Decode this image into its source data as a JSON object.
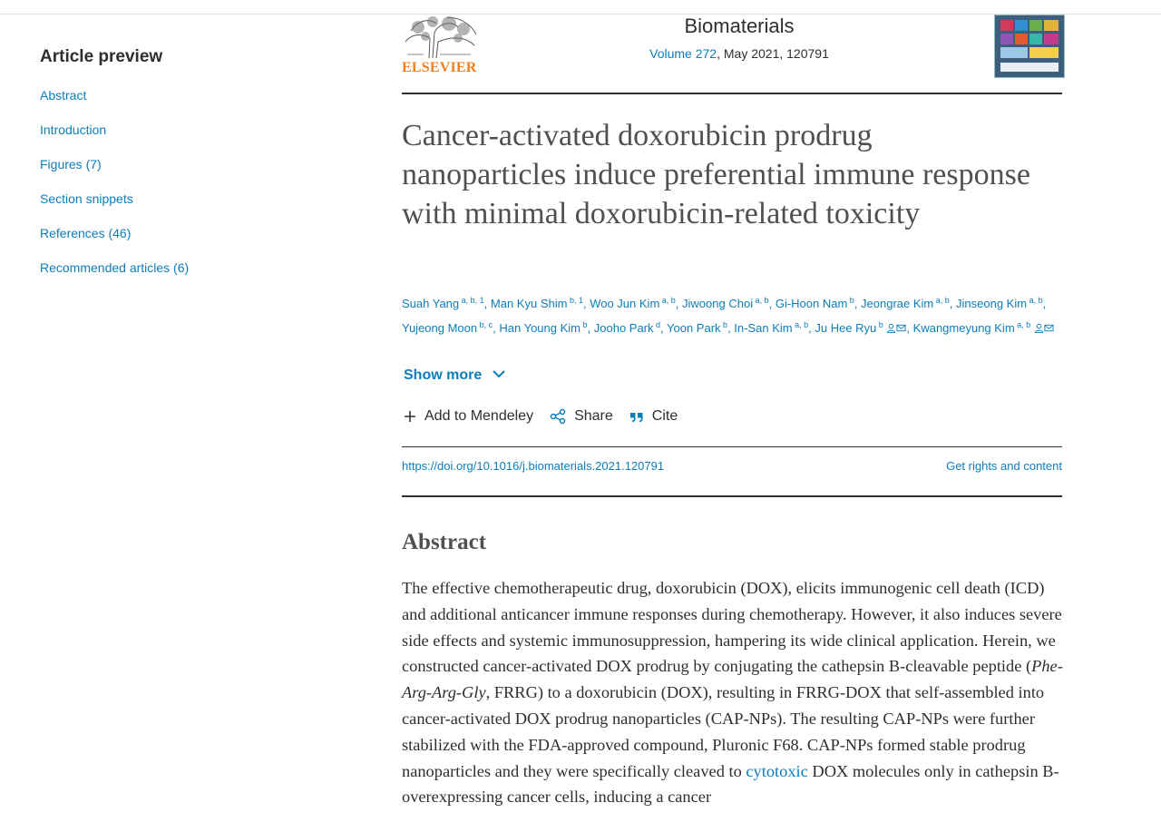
{
  "sidebar": {
    "heading": "Article preview",
    "items": [
      "Abstract",
      "Introduction",
      "Figures (7)",
      "Section snippets",
      "References (46)",
      "Recommended articles (6)"
    ]
  },
  "header": {
    "publisher": "ELSEVIER",
    "journal": "Biomaterials",
    "volume_link": "Volume 272",
    "volume_rest": ", May 2021, 120791"
  },
  "article": {
    "title": "Cancer-activated doxorubicin prodrug nanoparticles induce preferential immune response with minimal doxorubicin-related toxicity",
    "authors": [
      {
        "name": "Suah Yang",
        "sup": "a, b, 1"
      },
      {
        "name": "Man Kyu Shim",
        "sup": "b, 1"
      },
      {
        "name": "Woo Jun Kim",
        "sup": "a, b"
      },
      {
        "name": "Jiwoong Choi",
        "sup": "a, b"
      },
      {
        "name": "Gi-Hoon Nam",
        "sup": "b"
      },
      {
        "name": "Jeongrae Kim",
        "sup": "a, b"
      },
      {
        "name": "Jinseong Kim",
        "sup": "a, b"
      },
      {
        "name": "Yujeong Moon",
        "sup": "b, c"
      },
      {
        "name": "Han Young Kim",
        "sup": "b"
      },
      {
        "name": "Jooho Park",
        "sup": "d"
      },
      {
        "name": "Yoon Park",
        "sup": "b"
      },
      {
        "name": "In-San Kim",
        "sup": "a, b"
      },
      {
        "name": "Ju Hee Ryu",
        "sup": "b"
      },
      {
        "name": "Kwangmeyung Kim",
        "sup": "a, b"
      }
    ],
    "show_more": "Show more",
    "actions": {
      "mendeley": "Add to Mendeley",
      "share": "Share",
      "cite": "Cite"
    },
    "doi": "https://doi.org/10.1016/j.biomaterials.2021.120791",
    "rights": "Get rights and content"
  },
  "abstract": {
    "heading": "Abstract",
    "text_1": "The effective chemotherapeutic drug, doxorubicin (DOX), elicits immunogenic cell death (ICD) and additional anticancer immune responses during chemotherapy. However, it also induces severe side effects and systemic immunosuppression, hampering its wide clinical application. Herein, we constructed cancer-activated DOX prodrug by conjugating the cathepsin B-cleavable peptide (",
    "text_italic": "Phe-Arg-Arg-Gly",
    "text_2": ", FRRG) to a doxorubicin (DOX), resulting in FRRG-DOX that self-assembled into cancer-activated DOX prodrug nanoparticles (CAP-NPs). The resulting CAP-NPs were further stabilized with the FDA-approved compound, Pluronic F68. CAP-NPs formed stable prodrug nanoparticles and they were specifically cleaved to ",
    "text_link": "cytotoxic",
    "text_3": " DOX molecules only in cathepsin B-overexpressing cancer cells, inducing a cancer"
  },
  "colors": {
    "link": "#0c7dbb",
    "publisher_orange": "#f08020",
    "text": "#2e2e2e",
    "title": "#505050"
  },
  "icons": [
    "plus-icon",
    "share-icon",
    "cite-quote-icon",
    "chevron-down-icon",
    "person-icon",
    "envelope-icon"
  ]
}
